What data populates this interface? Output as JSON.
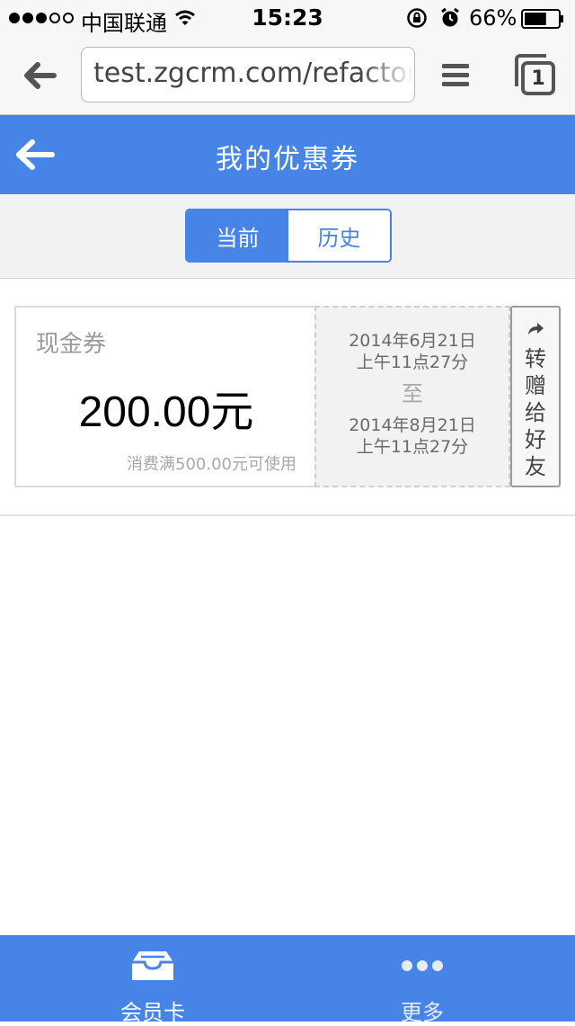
{
  "status_bar": {
    "carrier": "中国联通",
    "time": "15:23",
    "battery_percent": "66%",
    "battery_level": 0.66,
    "signal_bars_filled": 3,
    "signal_bars_total": 5
  },
  "browser": {
    "url": "test.zgcrm.com/refactor/",
    "tab_count": "1"
  },
  "header": {
    "title": "我的优惠券"
  },
  "segments": {
    "current": "当前",
    "history": "历史",
    "selected": "current"
  },
  "coupon": {
    "type": "现金券",
    "amount": "200.00元",
    "condition": "消费满500.00元可使用",
    "start_date": "2014年6月21日",
    "start_time": "上午11点27分",
    "to": "至",
    "end_date": "2014年8月21日",
    "end_time": "上午11点27分",
    "share_label": "转赠给好友"
  },
  "tab_bar": {
    "member_card": "会员卡",
    "more": "更多"
  },
  "colors": {
    "accent": "#4684e8",
    "status_bar_bg": "#f7f7f7"
  },
  "icons": {
    "back": "arrow-left-icon",
    "menu": "hamburger-icon",
    "tabs": "tabs-icon",
    "share": "share-arrow-icon",
    "member_card": "card-tray-icon",
    "more": "ellipsis-icon"
  }
}
